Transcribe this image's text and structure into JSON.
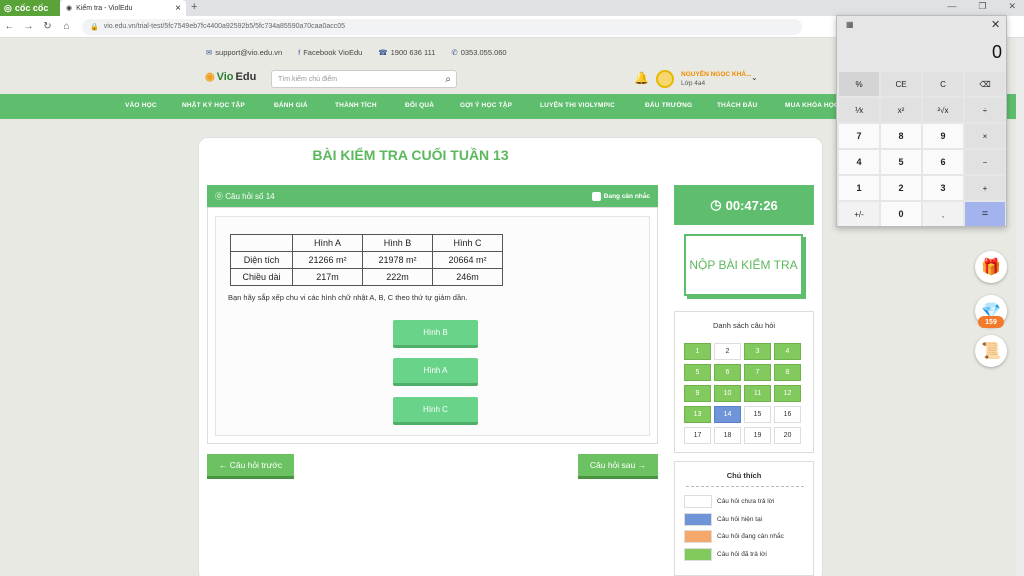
{
  "browser": {
    "brand": "cốc cốc",
    "tab_title": "Kiểm tra - ViolEdu",
    "url": "vio.edu.vn/trial-test/5fc7549eb7fc4400a92592b5/5fc734a85590a70caa0acc05"
  },
  "site": {
    "support_email": "support@vio.edu.vn",
    "facebook": "Facebook VioEdu",
    "phone1": "1900 636 111",
    "phone2": "0353.055.060",
    "logo_prefix": "Vio",
    "logo_suffix": "Edu",
    "search_placeholder": "Tìm kiếm chủ điểm",
    "user_name": "NGUYỄN NGỌC KHÁ...",
    "user_class": "Lớp 4a4",
    "nav": [
      "VÀO HỌC",
      "NHẬT KÝ HỌC TẬP",
      "ĐÁNH GIÁ",
      "THÀNH TÍCH",
      "ĐỔI QUÀ",
      "GỢI Ý HỌC TẬP",
      "LUYỆN THI VIOLYMPIC",
      "ĐẤU TRƯỜNG",
      "THÁCH ĐẤU",
      "MUA KHÓA HỌC"
    ]
  },
  "test": {
    "title": "BÀI KIỂM TRA CUỐI TUẦN 13",
    "question_label": "Câu hỏi số 14",
    "flag_label": "Đang cân nhắc",
    "table": {
      "headers": [
        "",
        "Hình A",
        "Hình B",
        "Hình C"
      ],
      "rows": [
        [
          "Diện tích",
          "21266 m²",
          "21978 m²",
          "20664 m²"
        ],
        [
          "Chiều dài",
          "217m",
          "222m",
          "246m"
        ]
      ]
    },
    "question_text": "Bạn hãy sắp xếp chu vi các hình chữ nhật A, B, C theo thứ tự giảm dần.",
    "answers": [
      "Hình B",
      "Hình A",
      "Hình C"
    ],
    "prev_label": "Câu hỏi trước",
    "next_label": "Câu hỏi sau"
  },
  "sidebar": {
    "timer": "00:47:26",
    "submit_label": "NỘP BÀI KIỂM TRA",
    "list_title": "Danh sách câu hỏi",
    "questions": [
      {
        "n": "1",
        "s": "answered"
      },
      {
        "n": "2",
        "s": "unanswered"
      },
      {
        "n": "3",
        "s": "answered"
      },
      {
        "n": "4",
        "s": "answered"
      },
      {
        "n": "5",
        "s": "answered"
      },
      {
        "n": "6",
        "s": "answered"
      },
      {
        "n": "7",
        "s": "answered"
      },
      {
        "n": "8",
        "s": "answered"
      },
      {
        "n": "9",
        "s": "answered"
      },
      {
        "n": "10",
        "s": "answered"
      },
      {
        "n": "11",
        "s": "answered"
      },
      {
        "n": "12",
        "s": "answered"
      },
      {
        "n": "13",
        "s": "answered"
      },
      {
        "n": "14",
        "s": "current"
      },
      {
        "n": "15",
        "s": "unanswered"
      },
      {
        "n": "16",
        "s": "unanswered"
      },
      {
        "n": "17",
        "s": "unanswered"
      },
      {
        "n": "18",
        "s": "unanswered"
      },
      {
        "n": "19",
        "s": "unanswered"
      },
      {
        "n": "20",
        "s": "unanswered"
      }
    ],
    "legend_title": "Chú thích",
    "legend": [
      {
        "label": "Câu hỏi chưa trả lời",
        "color": "#ffffff"
      },
      {
        "label": "Câu hỏi hiện tại",
        "color": "#6f94d8"
      },
      {
        "label": "Câu hỏi đang cân nhắc",
        "color": "#f5a86a"
      },
      {
        "label": "Câu hỏi đã trả lời",
        "color": "#82c95e"
      }
    ],
    "heart_count": "159"
  },
  "calculator": {
    "display": "0",
    "keys": [
      "%",
      "CE",
      "C",
      "⌫",
      "⅟x",
      "x²",
      "²√x",
      "÷",
      "7",
      "8",
      "9",
      "×",
      "4",
      "5",
      "6",
      "−",
      "1",
      "2",
      "3",
      "+",
      "+/-",
      "0",
      ",",
      "="
    ]
  }
}
